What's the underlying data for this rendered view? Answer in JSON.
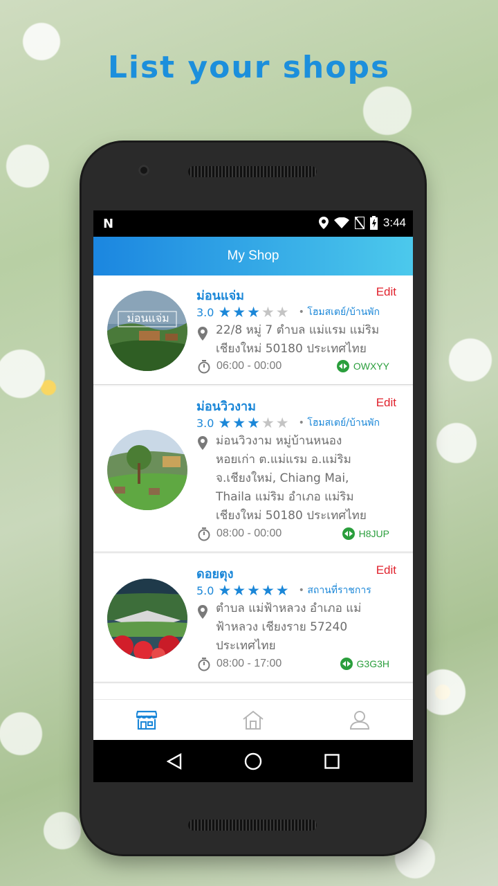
{
  "headline": "List your shops",
  "status_bar": {
    "left_icon": "n-notification-icon",
    "time": "3:44",
    "icons": [
      "location-icon",
      "wifi-icon",
      "no-sim-icon",
      "battery-charging-icon"
    ]
  },
  "app_bar": {
    "title": "My Shop"
  },
  "shops": [
    {
      "name": "ม่อนแจ่ม",
      "edit_label": "Edit",
      "rating": "3.0",
      "stars": 3,
      "category": "โฮมสเตย์/บ้านพัก",
      "address_lines": [
        "22/8 หมู่ 7 ตำบล แม่แรม แม่ริม",
        "เชียงใหม่ 50180 ประเทศไทย"
      ],
      "hours": "06:00 - 00:00",
      "code": "OWXYY",
      "image_label": "ม่อนแจ่ม"
    },
    {
      "name": "ม่อนวิวงาม",
      "edit_label": "Edit",
      "rating": "3.0",
      "stars": 3,
      "category": "โฮมสเตย์/บ้านพัก",
      "address_lines": [
        "ม่อนวิวงาม หมู่บ้านหนอง",
        "หอยเก่า ต.แม่แรม อ.แม่ริม",
        "จ.เชียงใหม่, Chiang Mai,",
        "Thaila แม่ริม อำเภอ แม่ริม",
        "เชียงใหม่ 50180 ประเทศไทย"
      ],
      "hours": "08:00 - 00:00",
      "code": "H8JUP"
    },
    {
      "name": "ดอยตุง",
      "edit_label": "Edit",
      "rating": "5.0",
      "stars": 5,
      "category": "สถานที่ราชการ",
      "address_lines": [
        "ตำบล แม่ฟ้าหลวง อำเภอ แม่",
        "ฟ้าหลวง เชียงราย 57240",
        "ประเทศไทย"
      ],
      "hours": "08:00 - 17:00",
      "code": "G3G3H"
    }
  ],
  "bottom_nav": [
    {
      "name": "shop-tab",
      "icon": "store-icon",
      "active": true,
      "color": "#1b87d8"
    },
    {
      "name": "home-tab",
      "icon": "home-icon",
      "active": false,
      "color": "#b5b5b5"
    },
    {
      "name": "profile-tab",
      "icon": "person-icon",
      "active": false,
      "color": "#b5b5b5"
    }
  ],
  "system_nav": [
    "back-icon",
    "home-circle-icon",
    "recents-icon"
  ],
  "colors": {
    "accent": "#1b87d8",
    "edit": "#e0212c",
    "code": "#2a9e3c",
    "headline": "#1c8fdc"
  }
}
